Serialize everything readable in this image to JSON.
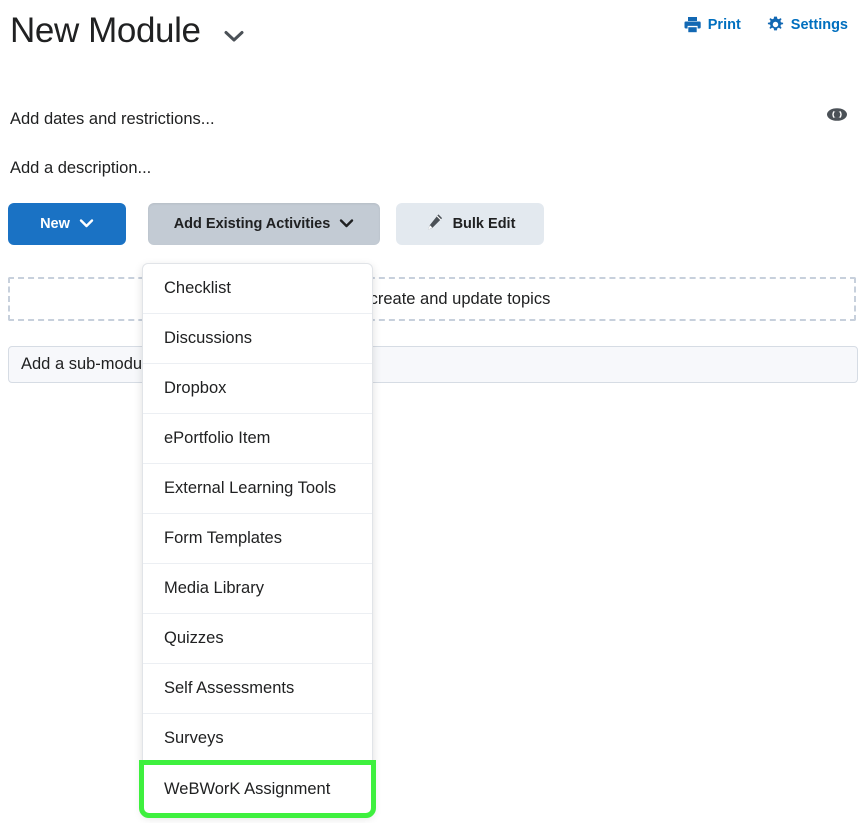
{
  "header": {
    "title": "New Module",
    "title_chevron_icon": "chevron-down-icon",
    "actions": [
      {
        "label": "Print",
        "icon": "printer-icon",
        "color": "#006fbf"
      },
      {
        "label": "Settings",
        "icon": "gear-icon",
        "color": "#006fbf"
      }
    ]
  },
  "meta": {
    "dates_link": "Add dates and restrictions...",
    "description_link": "Add a description...",
    "visibility_icon": "eye-icon"
  },
  "toolbar": {
    "new_label": "New",
    "new_chevron_icon": "chevron-down-icon",
    "add_existing_label": "Add Existing Activities",
    "add_existing_chevron_icon": "chevron-down-icon",
    "bulk_edit_label": "Bulk Edit",
    "bulk_edit_icon": "pencil-icon",
    "colors": {
      "new_bg": "#1a72c4",
      "add_existing_bg": "#c3cbd4",
      "bulk_edit_bg": "#e3e9ef"
    }
  },
  "drop_zone": {
    "text": "here to create and update topics"
  },
  "submodule": {
    "placeholder": "Add a sub-module..."
  },
  "activities_menu": {
    "highlight_color": "#3ef03e",
    "highlighted_item": "WeBWorK Assignment",
    "items": [
      {
        "label": "Checklist"
      },
      {
        "label": "Discussions"
      },
      {
        "label": "Dropbox"
      },
      {
        "label": "ePortfolio Item"
      },
      {
        "label": "External Learning Tools"
      },
      {
        "label": "Form Templates"
      },
      {
        "label": "Media Library"
      },
      {
        "label": "Quizzes"
      },
      {
        "label": "Self Assessments"
      },
      {
        "label": "Surveys"
      },
      {
        "label": "WeBWorK Assignment"
      }
    ]
  }
}
